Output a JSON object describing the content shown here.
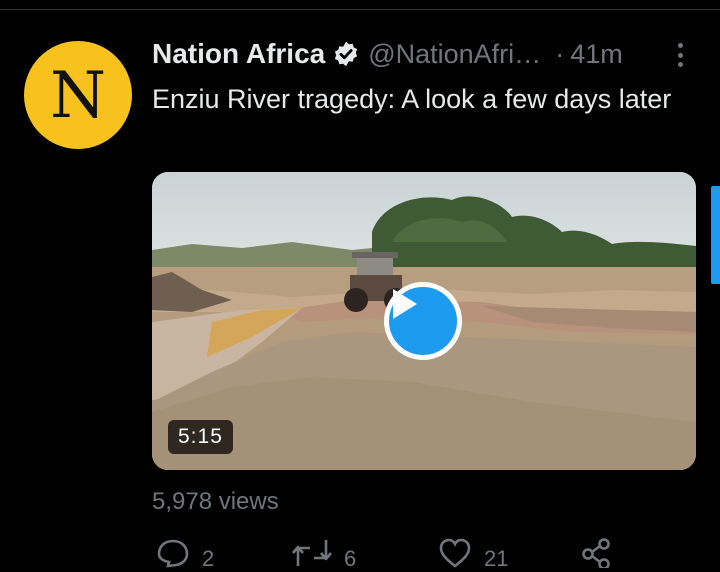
{
  "tweet": {
    "avatar_letter": "N",
    "author_name": "Nation Africa",
    "handle": "@NationAfri…",
    "separator": "·",
    "time": "41m",
    "text": "Enziu River tragedy: A look a few days later",
    "views": "5,978 views"
  },
  "video": {
    "duration": "5:15"
  },
  "actions": {
    "reply_count": "2",
    "retweet_count": "6",
    "like_count": "21"
  },
  "colors": {
    "background": "#000000",
    "accent": "#1d9bf0",
    "avatar": "#f7c21d",
    "muted_text": "#71767b"
  },
  "icons": [
    "verified-badge-icon",
    "more-options-icon",
    "play-icon",
    "reply-icon",
    "retweet-icon",
    "like-icon",
    "share-icon"
  ]
}
